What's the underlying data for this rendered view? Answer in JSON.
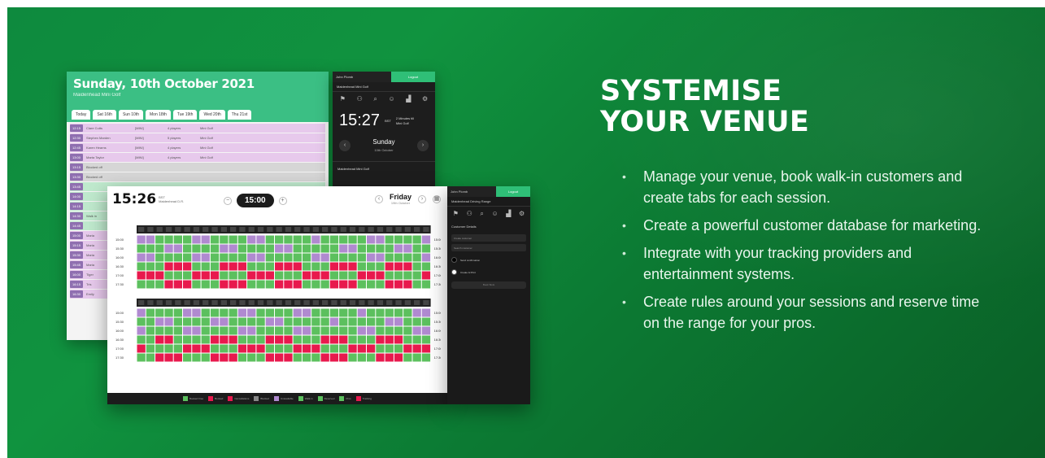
{
  "hero": {
    "headline_line1": "SYSTEMISE",
    "headline_line2": "YOUR VENUE",
    "bullets": [
      "Manage your venue, book walk-in customers and create tabs for each session.",
      "Create a powerful customer database for marketing.",
      "Integrate with your tracking providers and entertainment systems.",
      "Create rules around your sessions and reserve time on the range for your pros."
    ]
  },
  "back_screen": {
    "title": "Sunday, 10th October 2021",
    "subtitle": "Maidenhead Mini Golf",
    "tabs": [
      "Today",
      "Sat 16th",
      "Sun 10th",
      "Mon 18th",
      "Tue 19th",
      "Wed 20th",
      "Thu 21st"
    ],
    "rows": [
      {
        "time": "12:15",
        "name": "Clare Cutts",
        "mode": "[MINI]",
        "players": "4 players",
        "place": "Mini Golf",
        "color": "#e7c9ec"
      },
      {
        "time": "12:30",
        "name": "Stephen Marden",
        "mode": "[MINI]",
        "players": "5 players",
        "place": "Mini Golf",
        "color": "#e7c9ec"
      },
      {
        "time": "12:45",
        "name": "Karen Hearns",
        "mode": "[MINI]",
        "players": "4 players",
        "place": "Mini Golf",
        "color": "#e7c9ec"
      },
      {
        "time": "13:00",
        "name": "Marta Taylor",
        "mode": "[MINI]",
        "players": "4 players",
        "place": "Mini Golf",
        "color": "#e7c9ec"
      },
      {
        "time": "13:15",
        "name": "Blocked off",
        "mode": "",
        "players": "",
        "place": "",
        "color": "#d6d6d6"
      },
      {
        "time": "13:30",
        "name": "Blocked off",
        "mode": "",
        "players": "",
        "place": "",
        "color": "#d6d6d6"
      },
      {
        "time": "13:45",
        "name": "",
        "mode": "",
        "players": "",
        "place": "",
        "color": "#bfe9cd"
      },
      {
        "time": "14:00",
        "name": "",
        "mode": "",
        "players": "",
        "place": "",
        "color": "#bfe9cd"
      },
      {
        "time": "14:15",
        "name": "",
        "mode": "",
        "players": "",
        "place": "",
        "color": "#bfe9cd"
      },
      {
        "time": "14:30",
        "name": "Walk in",
        "mode": "",
        "players": "",
        "place": "",
        "color": "#bfe9cd"
      },
      {
        "time": "14:45",
        "name": "",
        "mode": "",
        "players": "",
        "place": "",
        "color": "#bfe9cd"
      },
      {
        "time": "15:00",
        "name": "Maria",
        "mode": "",
        "players": "",
        "place": "",
        "color": "#e7c9ec"
      },
      {
        "time": "15:15",
        "name": "Maria",
        "mode": "",
        "players": "",
        "place": "",
        "color": "#e7c9ec"
      },
      {
        "time": "15:30",
        "name": "Maria",
        "mode": "",
        "players": "",
        "place": "",
        "color": "#e7c9ec"
      },
      {
        "time": "15:45",
        "name": "Maria",
        "mode": "",
        "players": "",
        "place": "",
        "color": "#e7c9ec"
      },
      {
        "time": "16:00",
        "name": "Tiger",
        "mode": "",
        "players": "",
        "place": "",
        "color": "#e7c9ec"
      },
      {
        "time": "16:15",
        "name": "Tris",
        "mode": "",
        "players": "",
        "place": "",
        "color": "#e7c9ec"
      },
      {
        "time": "16:30",
        "name": "Emily",
        "mode": "",
        "players": "",
        "place": "",
        "color": "#e7c9ec"
      }
    ]
  },
  "panel1": {
    "user": "John Plomb",
    "logout": "Logout",
    "venue": "Maidenhead Mini Golf",
    "icons": [
      "flag-icon",
      "add-user-icon",
      "search-icon",
      "user-icon",
      "chart-icon",
      "settings-icon"
    ],
    "time": "15:27",
    "badge": "BST",
    "next": "2 Minutes till",
    "next_sub": "Mini Golf",
    "day": "Sunday",
    "date": "10th October",
    "footer": "Maidenhead Mini Golf"
  },
  "front_screen": {
    "time": "15:26",
    "badge": "BST",
    "venue": "Maidenhead D.R.",
    "slot": "15:00",
    "day": "Friday",
    "date": "19th October",
    "time_labels_top": [
      "15:00",
      "15:30",
      "16:00",
      "16:30",
      "17:00",
      "17:30"
    ],
    "time_labels_bottom": [
      "15:00",
      "15:30",
      "16:00",
      "16:30",
      "17:00",
      "17:30"
    ],
    "legend": [
      "Booked Free",
      "Booked",
      "Cancellations",
      "Blocked",
      "Unavailable",
      "Walk-in",
      "Reserved",
      "Pros",
      "Tracking"
    ],
    "colors": {
      "green": "#5cc05e",
      "purple": "#b08ad0",
      "red": "#e8194d",
      "dark": "#222222"
    }
  },
  "panel2": {
    "user": "John Plomb",
    "logout": "Logout",
    "venue": "Maidenhead Driving Range",
    "section": "Customer Details",
    "field1": "Create customer",
    "field2": "Search customer",
    "check1": "Send confirmation",
    "check2": "Create & Print",
    "button": "Book Slots"
  }
}
